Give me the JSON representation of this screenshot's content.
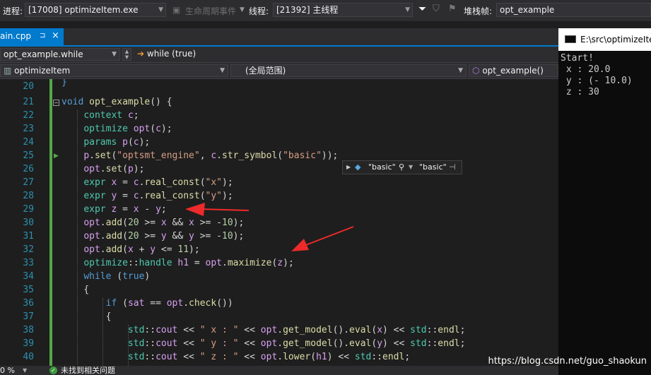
{
  "toolbar": {
    "process_label": "进程:",
    "process_value": "[17008] optimizeItem.exe",
    "lifecycle_label": "生命周期事件",
    "thread_label": "线程:",
    "thread_value": "[21392] 主线程",
    "stack_label": "堆栈帧:",
    "stack_value": "opt_example"
  },
  "tab": {
    "label": "ain.cpp",
    "pin": "⊐",
    "close": "×"
  },
  "nav1": {
    "scope": "opt_example.while",
    "statement": "while (true)"
  },
  "nav2": {
    "project": "optimizeItem",
    "range": "(全局范围)",
    "function": "opt_example()"
  },
  "tooltip": {
    "left": "\"basic\"",
    "right": "\"basic\""
  },
  "console": {
    "title": "E:\\src\\optimizeIte",
    "lines": [
      "Start!",
      " x : 20.0",
      " y : (- 10.0)",
      " z : 30"
    ]
  },
  "status": {
    "zoom": "0 %",
    "message": "未找到相关问题"
  },
  "watermark": "https://blog.csdn.net/guo_shaokun",
  "line_numbers": [
    "20",
    "21",
    "22",
    "23",
    "24",
    "25",
    "26",
    "27",
    "28",
    "29",
    "30",
    "31",
    "32",
    "33",
    "34",
    "35",
    "36",
    "37",
    "38",
    "39",
    "40"
  ]
}
